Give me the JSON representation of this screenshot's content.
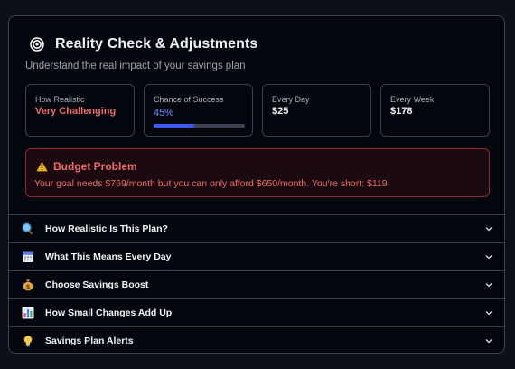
{
  "header": {
    "title": "Reality Check & Adjustments",
    "subtitle": "Understand the real impact of your savings plan"
  },
  "stats": [
    {
      "label": "How Realistic",
      "value": "Very Challenging"
    },
    {
      "label": "Chance of Success",
      "value": "45%",
      "progress": 0.45
    },
    {
      "label": "Every Day",
      "value": "$25"
    },
    {
      "label": "Every Week",
      "value": "$178"
    }
  ],
  "alert": {
    "title": "Budget Problem",
    "text": "Your goal needs $769/month but you can only afford $650/month. You're short: $119"
  },
  "sections": [
    {
      "label": "How Realistic Is This Plan?",
      "icon": "magnifier-icon"
    },
    {
      "label": "What This Means Every Day",
      "icon": "calendar-icon"
    },
    {
      "label": "Choose Savings Boost",
      "icon": "money-bag-icon"
    },
    {
      "label": "How Small Changes Add Up",
      "icon": "bar-chart-icon"
    },
    {
      "label": "Savings Plan Alerts",
      "icon": "light-bulb-icon"
    }
  ],
  "colors": {
    "accent": "#3a5cff",
    "warning": "#ef6b6b",
    "alert_border": "#8b2a2f",
    "background": "#04060d"
  }
}
